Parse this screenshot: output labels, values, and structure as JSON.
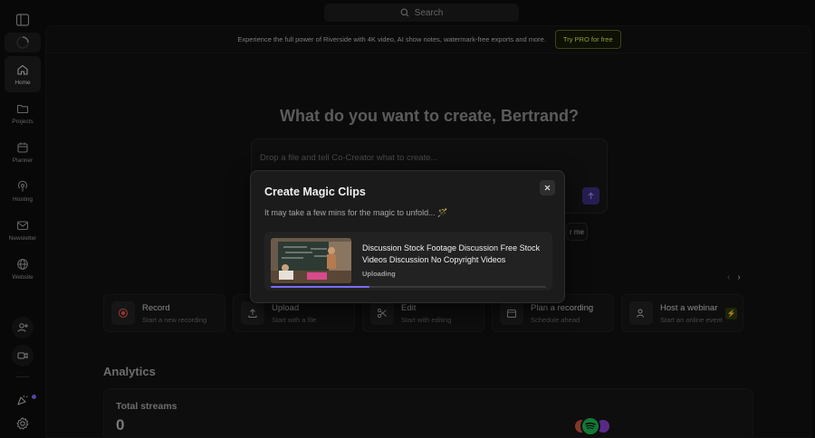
{
  "search": {
    "label": "Search"
  },
  "promo": {
    "text": "Experience the full power of Riverside with 4K video, AI show notes, watermark-free exports and more.",
    "button": "Try PRO for free"
  },
  "sidebar": {
    "items": [
      {
        "label": "Home",
        "icon": "home-icon",
        "active": true
      },
      {
        "label": "Projects",
        "icon": "folder-icon"
      },
      {
        "label": "Planner",
        "icon": "calendar-icon"
      },
      {
        "label": "Hosting",
        "icon": "podcast-icon"
      },
      {
        "label": "Newsletter",
        "icon": "mail-icon"
      },
      {
        "label": "Website",
        "icon": "globe-icon"
      }
    ]
  },
  "main": {
    "headline": "What do you want to create, Bertrand?",
    "prompt_placeholder": "Drop a file and tell Co-Creator what to create...",
    "chip_label": "r me",
    "cards": [
      {
        "title": "Record",
        "sub": "Start a new recording",
        "icon": "record-icon"
      },
      {
        "title": "Upload",
        "sub": "Start with a file",
        "icon": "upload-icon"
      },
      {
        "title": "Edit",
        "sub": "Start with editing",
        "icon": "scissors-icon"
      },
      {
        "title": "Plan a recording",
        "sub": "Schedule ahead",
        "icon": "calendar-icon"
      },
      {
        "title": "Host a webinar",
        "sub": "Start an online event",
        "icon": "people-icon"
      }
    ]
  },
  "analytics": {
    "title": "Analytics",
    "stat_label": "Total streams",
    "stat_value": "0"
  },
  "modal": {
    "title": "Create Magic Clips",
    "subtitle": "It may take a few mins for the magic to unfold... 🪄",
    "file_name": "Discussion Stock Footage Discussion Free Stock Videos Discussion No Copyright Videos",
    "status": "Uploading",
    "progress": 0.36
  },
  "colors": {
    "accent": "#7b6cf6",
    "pro": "#d3f25a"
  }
}
